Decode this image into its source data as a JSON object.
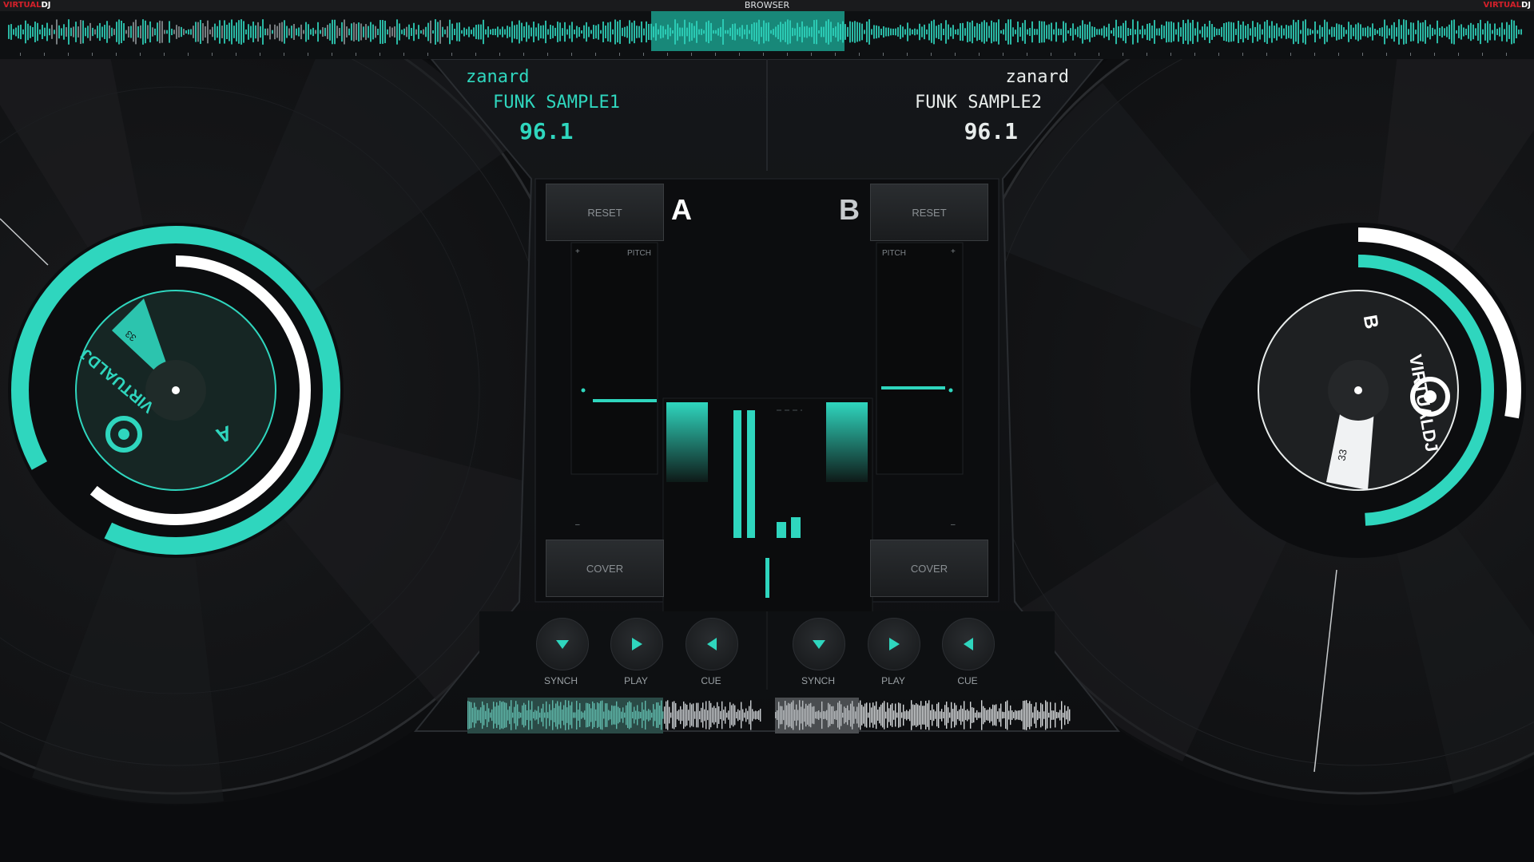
{
  "app": {
    "brand_left": {
      "v": "VIRTUAL",
      "dj": "DJ"
    },
    "brand_right": {
      "v": "VIRTUAL",
      "dj": "DJ"
    },
    "browser_tab": "BROWSER"
  },
  "colors": {
    "accent": "#2fd6be",
    "deck_b_text": "#e8eceb",
    "background": "#0b0c0e"
  },
  "deck_a": {
    "artist": "zanard",
    "title": "FUNK SAMPLE1",
    "bpm": "96.1",
    "letter": "A",
    "reset_label": "RESET",
    "pitch_label": "PITCH",
    "pitch_plus": "+",
    "pitch_minus": "–",
    "cover_label": "COVER",
    "synch_label": "SYNCH",
    "play_label": "PLAY",
    "cue_label": "CUE",
    "platter_label": "VIRTUALDJ",
    "platter_letter": "A",
    "rpm": "33",
    "play_progress": 0.62
  },
  "deck_b": {
    "artist": "zanard",
    "title": "FUNK SAMPLE2",
    "bpm": "96.1",
    "letter": "B",
    "reset_label": "RESET",
    "pitch_label": "PITCH",
    "pitch_plus": "+",
    "pitch_minus": "–",
    "cover_label": "COVER",
    "synch_label": "SYNCH",
    "play_label": "PLAY",
    "cue_label": "CUE",
    "platter_label": "VIRTUALDJ",
    "platter_letter": "B",
    "rpm": "33",
    "play_progress": 0.14
  },
  "icons": {
    "synch": "triangle-down-icon",
    "play": "play-icon",
    "cue": "triangle-left-icon"
  }
}
